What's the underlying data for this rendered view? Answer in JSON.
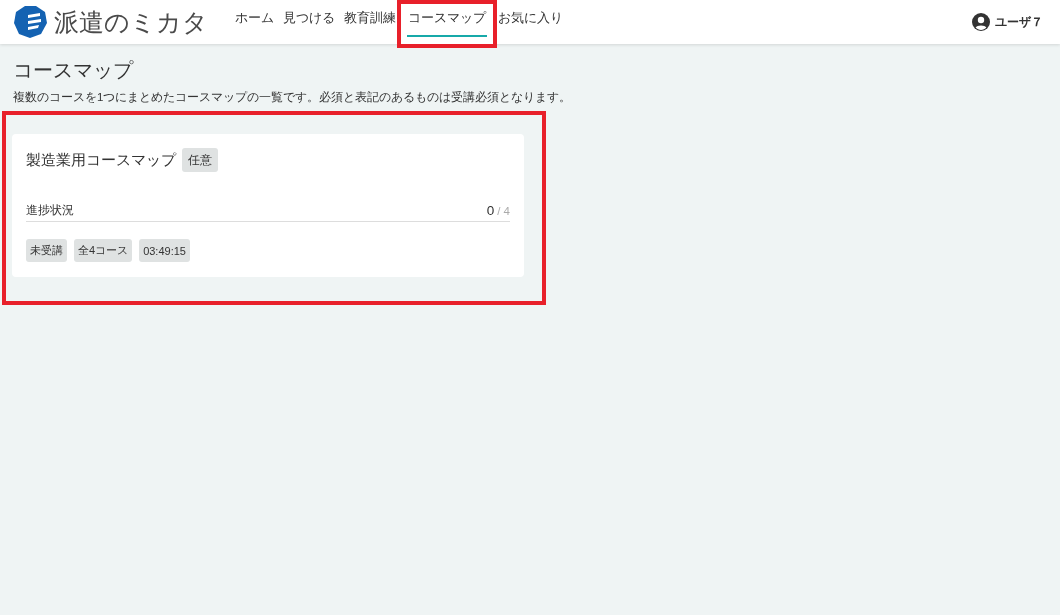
{
  "header": {
    "logo_text": "派遣のミカタ",
    "nav": [
      {
        "label": "ホーム",
        "selected": false,
        "highlighted": false
      },
      {
        "label": "見つける",
        "selected": false,
        "highlighted": false
      },
      {
        "label": "教育訓練",
        "selected": false,
        "highlighted": false
      },
      {
        "label": "コースマップ",
        "selected": true,
        "highlighted": true
      },
      {
        "label": "お気に入り",
        "selected": false,
        "highlighted": false
      }
    ],
    "user": "ユーザ７"
  },
  "page": {
    "title": "コースマップ",
    "description": "複数のコースを1つにまとめたコースマップの一覧です。必須と表記のあるものは受講必須となります。"
  },
  "course_maps": [
    {
      "title": "製造業用コースマップ",
      "badge": "任意",
      "highlighted": true,
      "progress": {
        "label": "進捗状況",
        "done": "0",
        "total": "/ 4"
      },
      "tags": [
        "未受講",
        "全4コース",
        "03:49:15"
      ]
    }
  ]
}
